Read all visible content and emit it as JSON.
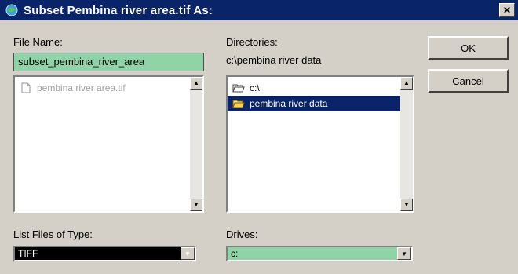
{
  "window": {
    "title": "Subset Pembina river area.tif As:",
    "close_label": "✕"
  },
  "file_name": {
    "label": "File Name:",
    "value": "subset_pembina_river_area",
    "files": [
      {
        "name": "pembina river area.tif",
        "icon": "document-icon"
      }
    ]
  },
  "directories": {
    "label": "Directories:",
    "current_path": "c:\\pembina river data",
    "items": [
      {
        "name": "c:\\",
        "icon": "open-folder-icon",
        "selected": false
      },
      {
        "name": "pembina river data",
        "icon": "open-folder-icon",
        "selected": true
      }
    ]
  },
  "buttons": {
    "ok": "OK",
    "cancel": "Cancel"
  },
  "file_type": {
    "label": "List Files of Type:",
    "value": "TIFF"
  },
  "drives": {
    "label": "Drives:",
    "value": "c:"
  },
  "colors": {
    "titlebar": "#0a246a",
    "selection": "#0a246a",
    "field_highlight": "#8fd4a6",
    "dialog_bg": "#d4d0c8"
  }
}
